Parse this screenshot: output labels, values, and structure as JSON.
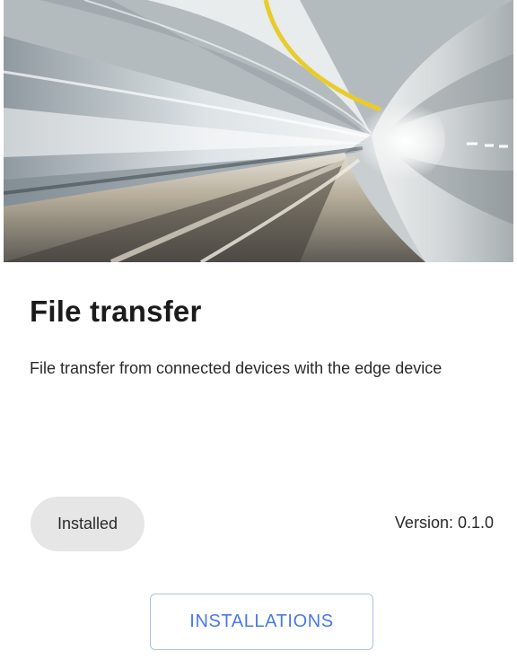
{
  "card": {
    "title": "File transfer",
    "description": "File transfer from connected devices with the edge device",
    "status_chip": "Installed",
    "version_text": "Version: 0.1.0",
    "installations_button": "INSTALLATIONS"
  },
  "colors": {
    "accent": "#4a78e6",
    "chip_background": "#e6e6e6",
    "button_border": "#a9c1f2",
    "tunnel_stripe": "#e8cc2e"
  }
}
